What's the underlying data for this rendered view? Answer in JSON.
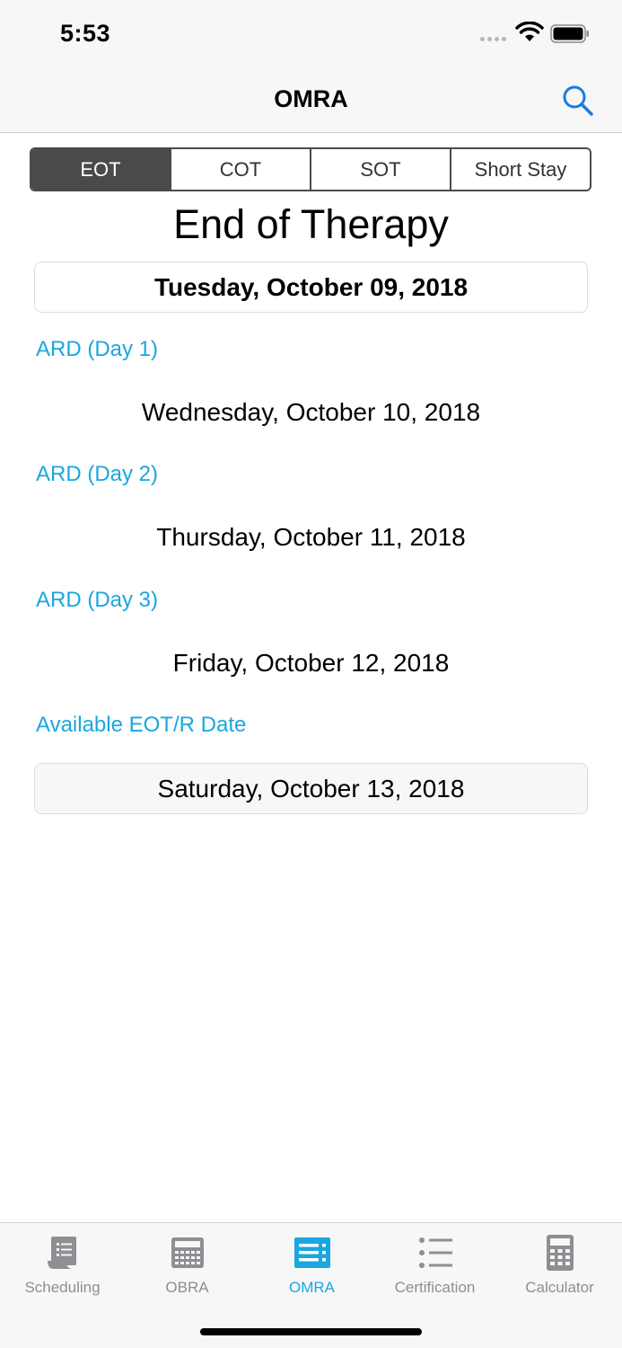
{
  "status_bar": {
    "time": "5:53"
  },
  "nav": {
    "title": "OMRA"
  },
  "segments": [
    {
      "label": "EOT",
      "active": true
    },
    {
      "label": "COT",
      "active": false
    },
    {
      "label": "SOT",
      "active": false
    },
    {
      "label": "Short Stay",
      "active": false
    }
  ],
  "page_title": "End of Therapy",
  "start_date": "Tuesday, October 09, 2018",
  "ard_days": [
    {
      "label": "ARD (Day 1)",
      "date": "Wednesday, October 10, 2018"
    },
    {
      "label": "ARD (Day 2)",
      "date": "Thursday, October 11, 2018"
    },
    {
      "label": "ARD (Day 3)",
      "date": "Friday, October 12, 2018"
    }
  ],
  "available": {
    "label": "Available EOT/R Date",
    "date": "Saturday, October 13, 2018"
  },
  "tabs": [
    {
      "label": "Scheduling",
      "icon": "scroll-icon",
      "active": false
    },
    {
      "label": "OBRA",
      "icon": "keypad-icon",
      "active": false
    },
    {
      "label": "OMRA",
      "icon": "list-panel-icon",
      "active": true
    },
    {
      "label": "Certification",
      "icon": "bullet-list-icon",
      "active": false
    },
    {
      "label": "Calculator",
      "icon": "calculator-icon",
      "active": false
    }
  ],
  "colors": {
    "accent": "#1aa6e0",
    "segment_active": "#4a4a4a",
    "tab_inactive": "#8e8e93",
    "search_icon": "#1a7be0"
  }
}
